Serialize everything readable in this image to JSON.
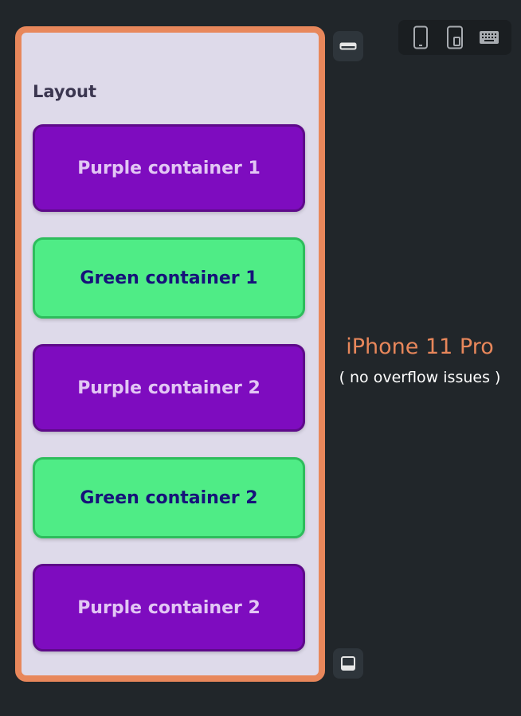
{
  "screen": {
    "title": "Layout",
    "containers": [
      {
        "label": "Purple container 1",
        "variant": "purple"
      },
      {
        "label": "Green container 1",
        "variant": "green"
      },
      {
        "label": "Purple container 2",
        "variant": "purple"
      },
      {
        "label": "Green container 2",
        "variant": "green"
      },
      {
        "label": "Purple container 2",
        "variant": "purple"
      }
    ]
  },
  "device_info": {
    "name": "iPhone 11 Pro",
    "note": "( no overflow issues )"
  },
  "toolbar": {
    "icons": [
      "phone-icon",
      "tablet-icon",
      "keyboard-icon"
    ]
  },
  "side_buttons": {
    "icons": [
      "status-bar-icon",
      "bottom-bar-icon"
    ]
  },
  "colors": {
    "background": "#21262a",
    "frame": "#e8875b",
    "screen": "#dedaea",
    "purple": "#7e0cbf",
    "purple_text": "#e2c6f4",
    "green": "#4fec86",
    "green_text": "#16127a",
    "accent_text": "#e8875b"
  }
}
